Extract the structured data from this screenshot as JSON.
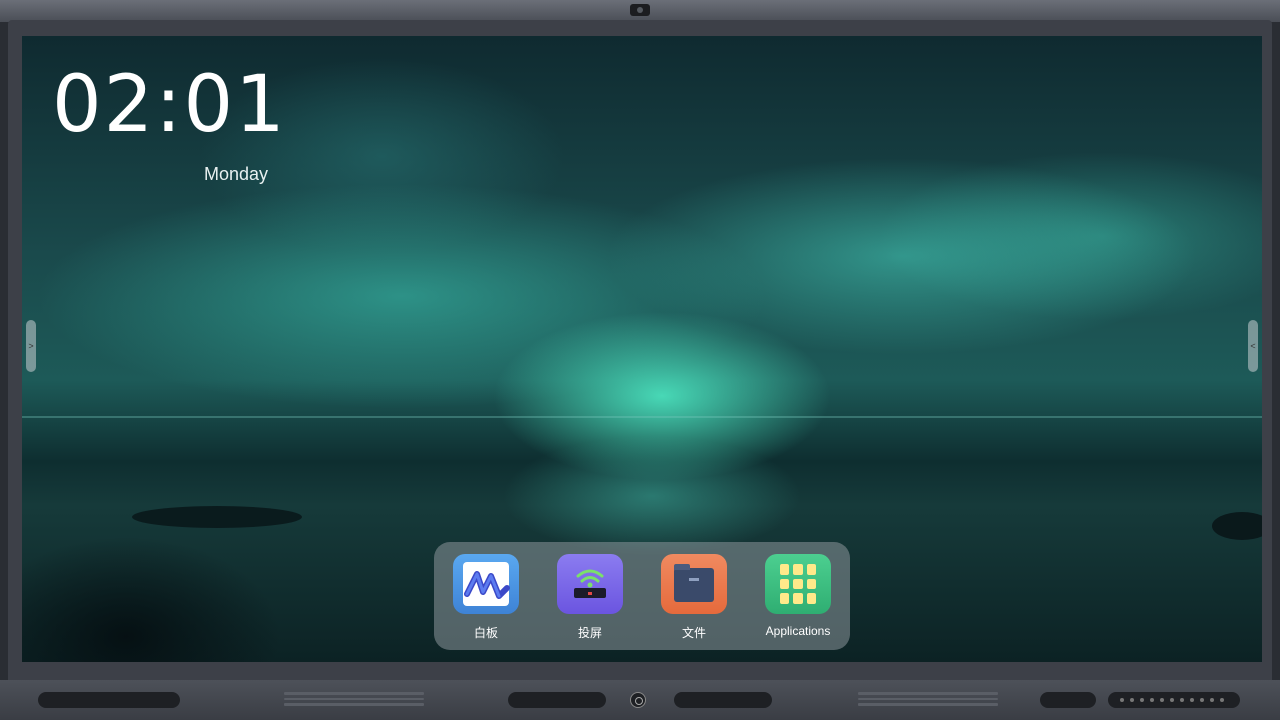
{
  "clock": {
    "time": "02:01",
    "day": "Monday"
  },
  "dock": {
    "items": [
      {
        "label": "白板",
        "icon": "whiteboard-icon"
      },
      {
        "label": "投屏",
        "icon": "screen-cast-icon"
      },
      {
        "label": "文件",
        "icon": "files-icon"
      },
      {
        "label": "Applications",
        "icon": "apps-grid-icon"
      }
    ]
  },
  "sidebar_handles": {
    "left_glyph": ">",
    "right_glyph": "<"
  },
  "colors": {
    "aurora": "#3fd3b8",
    "dock_bg": "#8c969b",
    "clock_text": "#ffffff"
  },
  "wallpaper": "aurora-over-sea"
}
